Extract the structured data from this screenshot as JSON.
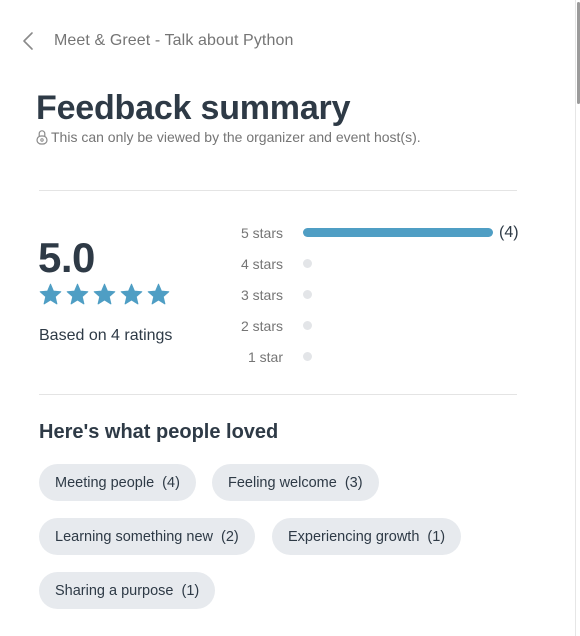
{
  "header": {
    "back_icon": "chevron-left-icon",
    "event_title": "Meet & Greet - Talk about Python"
  },
  "page": {
    "title": "Feedback summary",
    "privacy_icon": "lock-icon",
    "privacy_note": "This can only be viewed by the organizer and event host(s)."
  },
  "summary": {
    "average": "5.0",
    "stars_filled": 5,
    "stars_total": 5,
    "based_on": "Based on 4 ratings",
    "star_color": "#4f9ec4"
  },
  "distribution": {
    "max_count": 4,
    "bar_color": "#4f9ec4",
    "rows": [
      {
        "label": "5 stars",
        "count": 4,
        "count_text": "(4)"
      },
      {
        "label": "4 stars",
        "count": 0,
        "count_text": ""
      },
      {
        "label": "3 stars",
        "count": 0,
        "count_text": ""
      },
      {
        "label": "2 stars",
        "count": 0,
        "count_text": ""
      },
      {
        "label": "1 star",
        "count": 0,
        "count_text": ""
      }
    ]
  },
  "loved": {
    "heading": "Here's what people loved",
    "chips": [
      {
        "label": "Meeting people",
        "count": "(4)"
      },
      {
        "label": "Feeling welcome",
        "count": "(3)"
      },
      {
        "label": "Learning something new",
        "count": "(2)"
      },
      {
        "label": "Experiencing growth",
        "count": "(1)"
      },
      {
        "label": "Sharing a purpose",
        "count": "(1)"
      }
    ]
  }
}
